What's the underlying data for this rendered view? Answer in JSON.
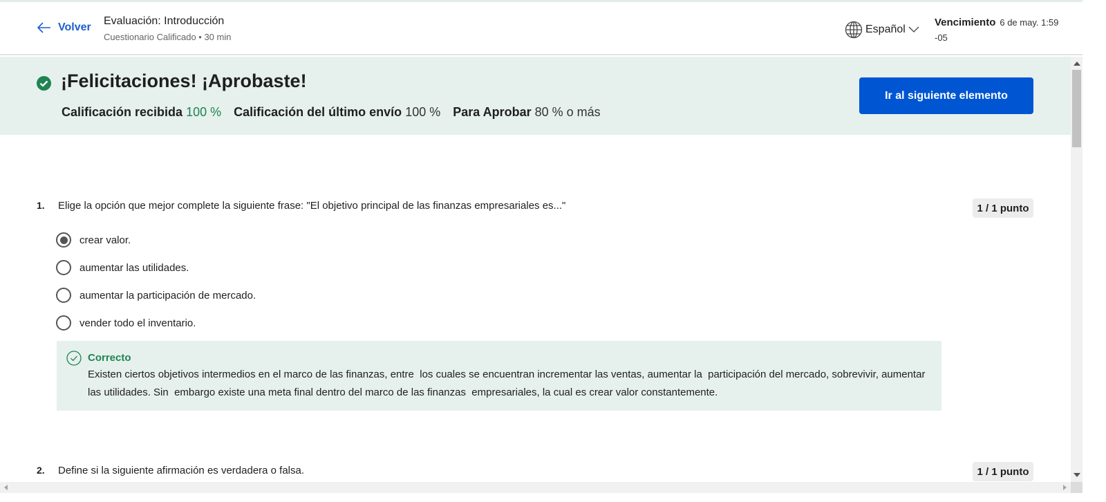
{
  "header": {
    "back_label": "Volver",
    "title": "Evaluación: Introducción",
    "subtitle": "Cuestionario Calificado • 30 min",
    "language": "Español",
    "due_label": "Vencimiento",
    "due_date": "6 de may. 1:59",
    "due_tz": "-05"
  },
  "banner": {
    "title": "¡Felicitaciones! ¡Aprobaste!",
    "received_label": "Calificación recibida",
    "received_value": "100 %",
    "last_label": "Calificación del último envío",
    "last_value": "100 %",
    "pass_label": "Para Aprobar",
    "pass_value": "80 % o más",
    "next_button": "Ir al siguiente elemento",
    "success_color": "#1f8354",
    "accent_color": "#0056d2"
  },
  "questions": [
    {
      "number": "1.",
      "text": "Elige la opción que mejor complete la siguiente frase: \"El objetivo principal de las finanzas empresariales es...\"",
      "points": "1 / 1 punto",
      "options": [
        "crear valor.",
        "aumentar las utilidades.",
        "aumentar la participación de mercado.",
        "vender todo el inventario."
      ],
      "selected": 0,
      "feedback_label": "Correcto",
      "feedback_text": "Existen ciertos objetivos intermedios en el marco de las finanzas, entre  los cuales se encuentran incrementar las ventas, aumentar la  participación del mercado, sobrevivir, aumentar las utilidades. Sin  embargo existe una meta final dentro del marco de las finanzas  empresariales, la cual es crear valor constantemente."
    },
    {
      "number": "2.",
      "text": "Define si la siguiente afirmación es verdadera o falsa.",
      "points": "1 / 1 punto"
    }
  ]
}
